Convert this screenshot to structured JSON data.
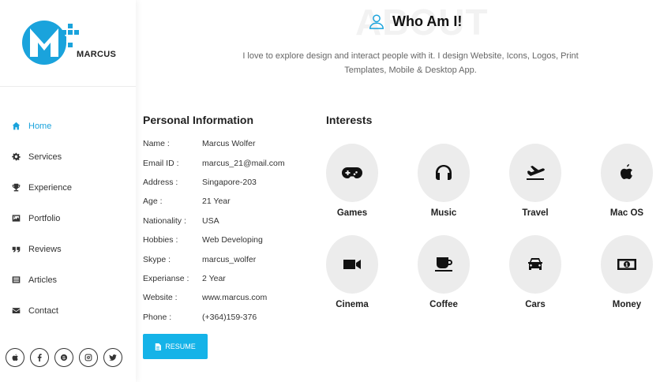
{
  "brand": {
    "name": "MARCUS",
    "accent": "#1aa3dc"
  },
  "nav": {
    "items": [
      {
        "label": "Home",
        "icon": "home-icon",
        "active": true
      },
      {
        "label": "Services",
        "icon": "gear-icon"
      },
      {
        "label": "Experience",
        "icon": "trophy-icon"
      },
      {
        "label": "Portfolio",
        "icon": "image-icon"
      },
      {
        "label": "Reviews",
        "icon": "quote-icon"
      },
      {
        "label": "Articles",
        "icon": "list-icon"
      },
      {
        "label": "Contact",
        "icon": "envelope-icon"
      }
    ]
  },
  "socials": [
    "apple-icon",
    "facebook-icon",
    "skype-icon",
    "instagram-icon",
    "twitter-icon"
  ],
  "about": {
    "background_text": "ABOUT",
    "title": "Who Am I!",
    "intro": "I love to explore design and interact people with it. I design Website, Icons, Logos, Print Templates, Mobile & Desktop App."
  },
  "personal": {
    "title": "Personal Information",
    "rows": [
      {
        "label": "Name :",
        "value": "Marcus Wolfer"
      },
      {
        "label": "Email ID :",
        "value": "marcus_21@mail.com"
      },
      {
        "label": "Address :",
        "value": "Singapore-203"
      },
      {
        "label": "Age :",
        "value": "21 Year"
      },
      {
        "label": "Nationality :",
        "value": "USA"
      },
      {
        "label": "Hobbies :",
        "value": "Web Developing"
      },
      {
        "label": "Skype :",
        "value": "marcus_wolfer"
      },
      {
        "label": "Experianse :",
        "value": "2 Year"
      },
      {
        "label": "Website :",
        "value": "www.marcus.com"
      },
      {
        "label": "Phone :",
        "value": "(+364)159-376"
      }
    ],
    "resume_label": "RESUME"
  },
  "interests": {
    "title": "Interests",
    "items": [
      {
        "label": "Games",
        "icon": "gamepad-icon"
      },
      {
        "label": "Music",
        "icon": "headphones-icon"
      },
      {
        "label": "Travel",
        "icon": "plane-icon"
      },
      {
        "label": "Mac OS",
        "icon": "apple-icon"
      },
      {
        "label": "Cinema",
        "icon": "video-camera-icon"
      },
      {
        "label": "Coffee",
        "icon": "coffee-cup-icon"
      },
      {
        "label": "Cars",
        "icon": "car-icon"
      },
      {
        "label": "Money",
        "icon": "money-icon"
      }
    ]
  }
}
